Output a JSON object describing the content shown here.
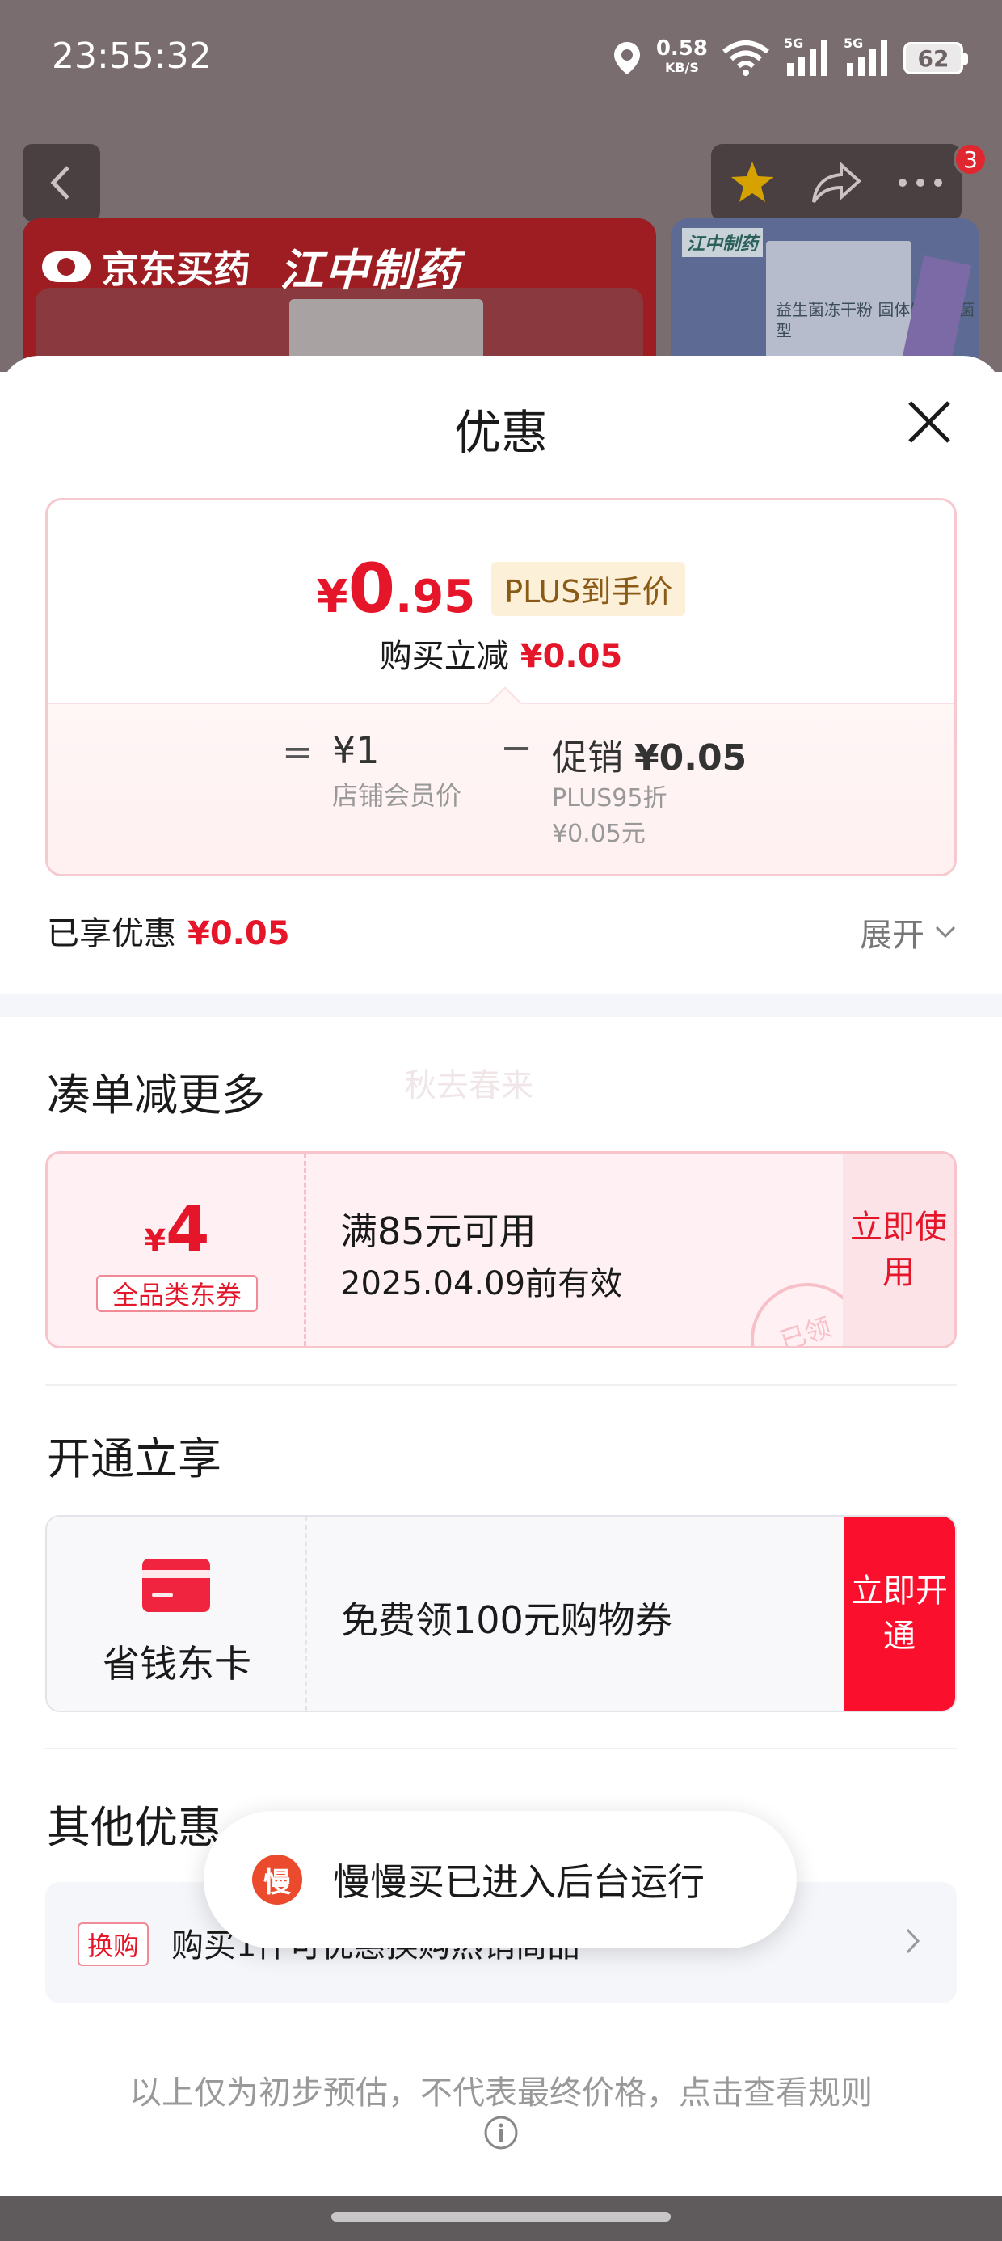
{
  "status_bar": {
    "time": "23:55:32",
    "net_speed_value": "0.58",
    "net_speed_unit": "KB/S",
    "signal1_label": "5G",
    "signal2_label": "5G",
    "battery": "62"
  },
  "nav": {
    "cart_badge": "3"
  },
  "banner": {
    "brand": "京东买药",
    "partner": "江中制药",
    "side_tag": "江中制药",
    "side_text": "益生菌冻干粉 固体饮料活菌型"
  },
  "sheet": {
    "title": "优惠"
  },
  "price_card": {
    "yen": "¥",
    "price_int": "0",
    "price_dec": ".95",
    "plus_tag": "PLUS到手价",
    "reduce_label": "购买立减",
    "reduce_value": "¥0.05",
    "eq": "=",
    "base_price": "¥1",
    "base_label": "店铺会员价",
    "minus": "−",
    "promo_label": "促销",
    "promo_value": "¥0.05",
    "promo_detail_1": "PLUS95折",
    "promo_detail_2": "¥0.05元"
  },
  "enjoyed": {
    "label": "已享优惠",
    "value": "¥0.05",
    "expand": "展开"
  },
  "section_bundle": {
    "title": "凑单减更多",
    "watermark": "秋去春来"
  },
  "coupon": {
    "yen": "¥",
    "amount": "4",
    "type": "全品类东券",
    "condition": "满85元可用",
    "validity": "2025.04.09前有效",
    "button": "立即使用",
    "stamp": "已领"
  },
  "section_member": {
    "title": "开通立享"
  },
  "member": {
    "card_name": "省钱东卡",
    "offer": "免费领100元购物券",
    "button": "立即开通"
  },
  "section_other": {
    "title": "其他优惠"
  },
  "other_row": {
    "tag": "换购",
    "text": "购买1件可优惠换购热销商品"
  },
  "toast": {
    "icon_text": "慢",
    "message": "慢慢买已进入后台运行"
  },
  "disclaimer": "以上仅为初步预估，不代表最终价格，点击查看规则",
  "colors": {
    "accent_red": "#e5162a",
    "plus_gold": "#8a5a17",
    "open_button": "#fa0f2d"
  }
}
